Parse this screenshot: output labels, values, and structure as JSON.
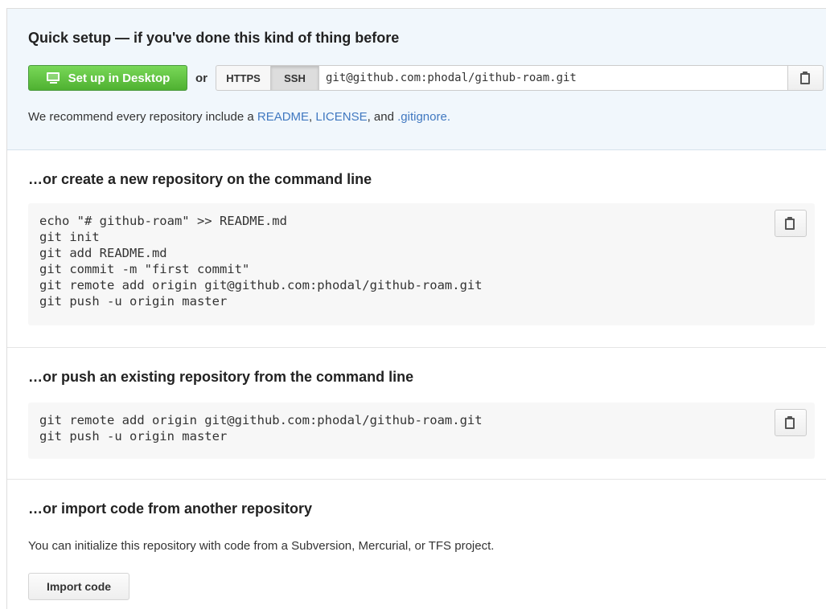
{
  "quick_setup": {
    "title": "Quick setup — if you've done this kind of thing before",
    "desktop_button": "Set up in Desktop",
    "or_label": "or",
    "protocols": {
      "https": "HTTPS",
      "ssh": "SSH",
      "selected": "SSH"
    },
    "clone_url": "git@github.com:phodal/github-roam.git",
    "recommend": {
      "prefix": "We recommend every repository include a ",
      "readme": "README",
      "sep1": ", ",
      "license": "LICENSE",
      "sep2": ", and ",
      "gitignore": ".gitignore",
      "suffix": "."
    }
  },
  "new_repo": {
    "title": "…or create a new repository on the command line",
    "lines": [
      "echo \"# github-roam\" >> README.md",
      "git init",
      "git add README.md",
      "git commit -m \"first commit\"",
      "git remote add origin git@github.com:phodal/github-roam.git",
      "git push -u origin master"
    ]
  },
  "existing_repo": {
    "title": "…or push an existing repository from the command line",
    "lines": [
      "git remote add origin git@github.com:phodal/github-roam.git",
      "git push -u origin master"
    ]
  },
  "import": {
    "title": "…or import code from another repository",
    "text": "You can initialize this repository with code from a Subversion, Mercurial, or TFS project.",
    "button": "Import code"
  },
  "icons": {
    "desktop": "desktop-icon",
    "clipboard": "clipboard-icon"
  },
  "colors": {
    "accent_green": "#55b735",
    "link_blue": "#4078c0",
    "quick_setup_bg": "#f1f7fc",
    "code_bg": "#f7f7f7"
  }
}
